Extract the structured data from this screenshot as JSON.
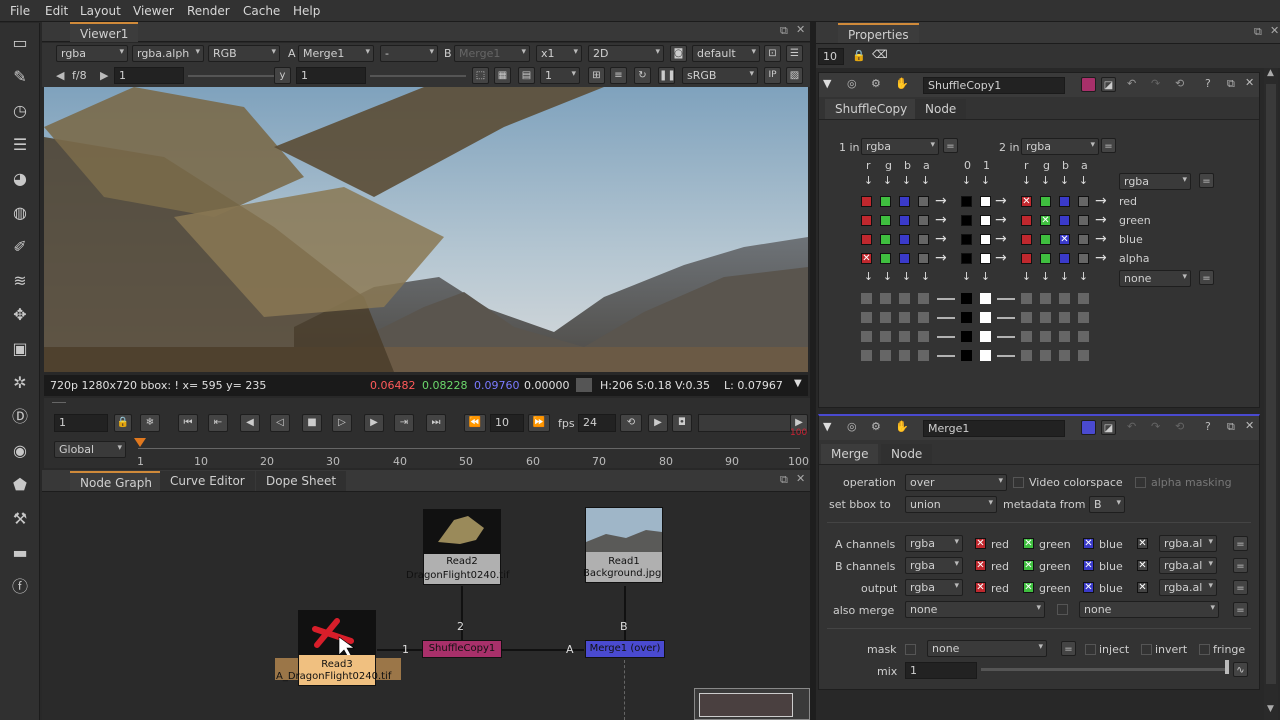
{
  "menu": [
    "File",
    "Edit",
    "Layout",
    "Viewer",
    "Render",
    "Cache",
    "Help"
  ],
  "viewer": {
    "tab": "Viewer1",
    "channels": "rgba",
    "alpha": "rgba.alph",
    "display": "RGB",
    "a_label": "A",
    "a_input": "Merge1",
    "op": "-",
    "b_label": "B",
    "b_input": "Merge1",
    "zoom": "x1",
    "mode": "2D",
    "lut_group": "default",
    "fstop": "f/8",
    "gain": "1",
    "y_label": "y",
    "gamma": "1",
    "proxy": "1",
    "colorspace": "sRGB",
    "info_left": "720p 1280x720 bbox: ! x= 595 y= 235",
    "r": "0.06482",
    "g": "0.08228",
    "b": "0.09760",
    "a": "0.00000",
    "hsv": "H:206 S:0.18 V:0.35",
    "lum": "L: 0.07967"
  },
  "timeline": {
    "frame": "1",
    "step": "10",
    "fps_label": "fps",
    "fps": "24",
    "range": "Global",
    "ticks": [
      "1",
      "10",
      "20",
      "30",
      "40",
      "50",
      "60",
      "70",
      "80",
      "90",
      "100"
    ],
    "end_marker": "100"
  },
  "nodegraph": {
    "tabs": [
      "Node Graph",
      "Curve Editor",
      "Dope Sheet"
    ],
    "read2_name": "Read2",
    "read2_file": "DragonFlight0240.tif",
    "read1_name": "Read1",
    "read1_file": "Background.jpg",
    "read3_name": "Read3",
    "read3_file": "A_DragonFlight0240.tif",
    "shuffle_name": "ShuffleCopy1",
    "merge_name": "Merge1 (over)",
    "pipe_1": "1",
    "pipe_2": "2",
    "pipe_a": "A",
    "pipe_b": "B"
  },
  "properties": {
    "title": "Properties",
    "max_panels": "10",
    "shuffle": {
      "name": "ShuffleCopy1",
      "tabs": [
        "ShuffleCopy",
        "Node"
      ],
      "in1_label": "1 in",
      "in1": "rgba",
      "in2_label": "2 in",
      "in2": "rgba",
      "col_headers_1": [
        "r",
        "g",
        "b",
        "a"
      ],
      "col_headers_mid": [
        "0",
        "1"
      ],
      "col_headers_2": [
        "r",
        "g",
        "b",
        "a"
      ],
      "out_layer": "rgba",
      "out_channels": [
        "red",
        "green",
        "blue",
        "alpha"
      ],
      "out2_layer": "none"
    },
    "merge": {
      "name": "Merge1",
      "tabs": [
        "Merge",
        "Node"
      ],
      "operation_label": "operation",
      "operation": "over",
      "video_colorspace": "Video colorspace",
      "alpha_masking": "alpha masking",
      "bbox_label": "set bbox to",
      "bbox": "union",
      "metadata_label": "metadata from",
      "metadata": "B",
      "rows": [
        {
          "label": "A channels",
          "layer": "rgba",
          "r": "red",
          "g": "green",
          "b": "blue",
          "extra": "rgba.al"
        },
        {
          "label": "B channels",
          "layer": "rgba",
          "r": "red",
          "g": "green",
          "b": "blue",
          "extra": "rgba.al"
        },
        {
          "label": "output",
          "layer": "rgba",
          "r": "red",
          "g": "green",
          "b": "blue",
          "extra": "rgba.al"
        }
      ],
      "also_merge_label": "also merge",
      "also_merge": "none",
      "also_merge2": "none",
      "mask_label": "mask",
      "mask": "none",
      "inject": "inject",
      "invert": "invert",
      "fringe": "fringe",
      "mix_label": "mix",
      "mix": "1"
    }
  },
  "colors": {
    "accent": "#d08a3a",
    "red": "#c0282e",
    "green": "#3fbf3f",
    "blue": "#3a3aca",
    "shuffle_node": "#a8306a",
    "merge_node": "#4a4ad0"
  }
}
